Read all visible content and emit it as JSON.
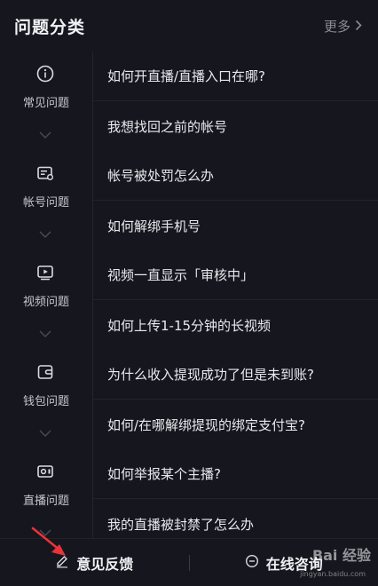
{
  "header": {
    "title": "问题分类",
    "more_label": "更多",
    "more_icon": "chevron-right-icon"
  },
  "categories": [
    {
      "label": "常见问题",
      "icon": "info-icon",
      "questions": [
        "如何开直播/直播入口在哪?",
        "我想找回之前的帐号"
      ]
    },
    {
      "label": "帐号问题",
      "icon": "account-card-icon",
      "questions": [
        "帐号被处罚怎么办",
        "如何解绑手机号"
      ]
    },
    {
      "label": "视频问题",
      "icon": "video-play-icon",
      "questions": [
        "视频一直显示「审核中」",
        "如何上传1-15分钟的长视频"
      ]
    },
    {
      "label": "钱包问题",
      "icon": "wallet-icon",
      "questions": [
        "为什么收入提现成功了但是未到账?",
        "如何/在哪解绑提现的绑定支付宝?"
      ]
    },
    {
      "label": "直播问题",
      "icon": "live-camera-icon",
      "questions": [
        "如何举报某个主播?",
        "我的直播被封禁了怎么办"
      ]
    }
  ],
  "footer": {
    "feedback_label": "意见反馈",
    "consult_label": "在线咨询"
  },
  "watermark": {
    "brand": "Bai 经验",
    "url": "jingyan.baidu.com"
  },
  "colors": {
    "background": "#15161e",
    "text": "#e9e9ed",
    "muted": "#8a8b93",
    "annotation_arrow": "#e8333a"
  }
}
